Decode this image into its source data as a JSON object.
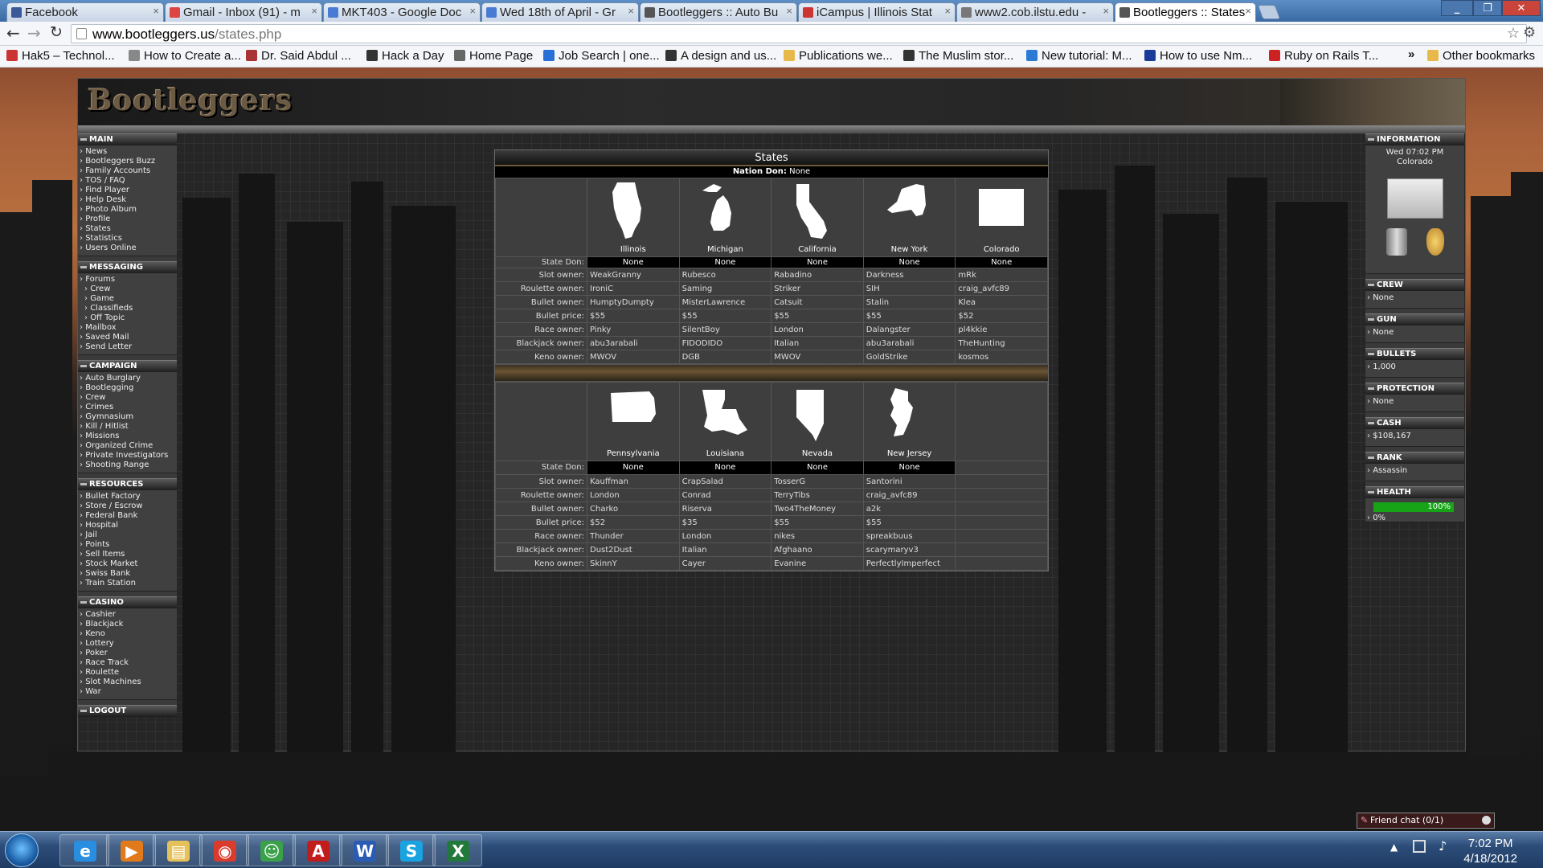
{
  "browser": {
    "tabs": [
      {
        "label": "Facebook",
        "color": "#3b5998"
      },
      {
        "label": "Gmail - Inbox (91) - m",
        "color": "#d44"
      },
      {
        "label": "MKT403 - Google Doc",
        "color": "#4a7bd4"
      },
      {
        "label": "Wed 18th of April - Gr",
        "color": "#4a7bd4"
      },
      {
        "label": "Bootleggers :: Auto Bu",
        "color": "#555"
      },
      {
        "label": "iCampus | Illinois Stat",
        "color": "#c33"
      },
      {
        "label": "www2.cob.ilstu.edu - ",
        "color": "#777"
      },
      {
        "label": "Bootleggers :: States",
        "color": "#555"
      }
    ],
    "url_host": "www.bootleggers.us",
    "url_path": "/states.php",
    "bookmarks": [
      {
        "label": "Hak5 – Technol...",
        "color": "#c33"
      },
      {
        "label": "How to Create a...",
        "color": "#888"
      },
      {
        "label": "Dr. Said Abdul ...",
        "color": "#a33"
      },
      {
        "label": "Hack a Day",
        "color": "#333"
      },
      {
        "label": "Home Page",
        "color": "#666"
      },
      {
        "label": "Job Search | one...",
        "color": "#2a6fd6"
      },
      {
        "label": "A design and us...",
        "color": "#333"
      },
      {
        "label": "Publications we...",
        "color": "#e7b94a"
      },
      {
        "label": "The Muslim stor...",
        "color": "#333"
      },
      {
        "label": "New tutorial: M...",
        "color": "#2a7ad6"
      },
      {
        "label": "How to use Nm...",
        "color": "#1a3a9a"
      },
      {
        "label": "Ruby on Rails T...",
        "color": "#c22"
      }
    ],
    "bookmarks_more": "»",
    "other_bookmarks": "Other bookmarks"
  },
  "site": {
    "logo": "Bootleggers"
  },
  "left_menu": [
    {
      "title": "MAIN",
      "items": [
        {
          "label": "News"
        },
        {
          "label": "Bootleggers Buzz"
        },
        {
          "label": "Family Accounts"
        },
        {
          "label": "TOS / FAQ"
        },
        {
          "label": "Find Player"
        },
        {
          "label": "Help Desk"
        },
        {
          "label": "Photo Album"
        },
        {
          "label": "Profile"
        },
        {
          "label": "States"
        },
        {
          "label": "Statistics"
        },
        {
          "label": "Users Online"
        }
      ]
    },
    {
      "title": "MESSAGING",
      "items": [
        {
          "label": "Forums"
        },
        {
          "label": "Crew",
          "sub": true
        },
        {
          "label": "Game",
          "sub": true
        },
        {
          "label": "Classifieds",
          "sub": true
        },
        {
          "label": "Off Topic",
          "sub": true
        },
        {
          "label": "Mailbox"
        },
        {
          "label": "Saved Mail"
        },
        {
          "label": "Send Letter"
        }
      ]
    },
    {
      "title": "CAMPAIGN",
      "items": [
        {
          "label": "Auto Burglary"
        },
        {
          "label": "Bootlegging"
        },
        {
          "label": "Crew"
        },
        {
          "label": "Crimes"
        },
        {
          "label": "Gymnasium"
        },
        {
          "label": "Kill / Hitlist"
        },
        {
          "label": "Missions"
        },
        {
          "label": "Organized Crime"
        },
        {
          "label": "Private Investigators"
        },
        {
          "label": "Shooting Range"
        }
      ]
    },
    {
      "title": "RESOURCES",
      "items": [
        {
          "label": "Bullet Factory"
        },
        {
          "label": "Store / Escrow"
        },
        {
          "label": "Federal Bank"
        },
        {
          "label": "Hospital"
        },
        {
          "label": "Jail"
        },
        {
          "label": "Points"
        },
        {
          "label": "Sell Items"
        },
        {
          "label": "Stock Market"
        },
        {
          "label": "Swiss Bank"
        },
        {
          "label": "Train Station"
        }
      ]
    },
    {
      "title": "CASINO",
      "items": [
        {
          "label": "Cashier"
        },
        {
          "label": "Blackjack"
        },
        {
          "label": "Keno"
        },
        {
          "label": "Lottery"
        },
        {
          "label": "Poker"
        },
        {
          "label": "Race Track"
        },
        {
          "label": "Roulette"
        },
        {
          "label": "Slot Machines"
        },
        {
          "label": "War"
        }
      ]
    },
    {
      "title": "LOGOUT",
      "items": []
    }
  ],
  "right_panel": {
    "info_title": "INFORMATION",
    "time": "Wed 07:02 PM",
    "location": "Colorado",
    "crew_title": "CREW",
    "crew": "None",
    "gun_title": "GUN",
    "gun": "None",
    "bullets_title": "BULLETS",
    "bullets": "1,000",
    "protection_title": "PROTECTION",
    "protection": "None",
    "cash_title": "CASH",
    "cash": "$108,167",
    "rank_title": "RANK",
    "rank": "Assassin",
    "health_title": "HEALTH",
    "health": "100%",
    "health_fraction": 1.0,
    "second_bar": "0%"
  },
  "states_panel": {
    "title": "States",
    "nation_don_label": "Nation Don:",
    "nation_don": "None",
    "row_labels": [
      "State Don:",
      "Slot owner:",
      "Roulette owner:",
      "Bullet owner:",
      "Bullet price:",
      "Race owner:",
      "Blackjack owner:",
      "Keno owner:"
    ],
    "group1": [
      {
        "name": "Illinois",
        "icon": "illinois-icon",
        "don": "None",
        "slot": "WeakGranny",
        "roulette": "IroniC",
        "bullet": "HumptyDumpty",
        "price": "$55",
        "race": "Pinky",
        "blackjack": "abu3arabali",
        "keno": "MWOV"
      },
      {
        "name": "Michigan",
        "icon": "michigan-icon",
        "don": "None",
        "slot": "Rubesco",
        "roulette": "Saming",
        "bullet": "MisterLawrence",
        "price": "$55",
        "race": "SilentBoy",
        "blackjack": "FIDODIDO",
        "keno": "DGB"
      },
      {
        "name": "California",
        "icon": "california-icon",
        "don": "None",
        "slot": "Rabadino",
        "roulette": "Striker",
        "bullet": "Catsuit",
        "price": "$55",
        "race": "London",
        "blackjack": "Italian",
        "keno": "MWOV"
      },
      {
        "name": "New York",
        "icon": "new-york-icon",
        "don": "None",
        "slot": "Darkness",
        "roulette": "SIH",
        "bullet": "Stalin",
        "price": "$55",
        "race": "Dalangster",
        "blackjack": "abu3arabali",
        "keno": "GoldStrike"
      },
      {
        "name": "Colorado",
        "icon": "colorado-icon",
        "don": "None",
        "slot": "mRk",
        "roulette": "craig_avfc89",
        "bullet": "Klea",
        "price": "$52",
        "race": "pl4kkie",
        "blackjack": "TheHunting",
        "keno": "kosmos"
      }
    ],
    "group2": [
      {
        "name": "Pennsylvania",
        "icon": "pennsylvania-icon",
        "don": "None",
        "slot": "Kauffman",
        "roulette": "London",
        "bullet": "Charko",
        "price": "$52",
        "race": "Thunder",
        "blackjack": "Dust2Dust",
        "keno": "SkinnY"
      },
      {
        "name": "Louisiana",
        "icon": "louisiana-icon",
        "don": "None",
        "slot": "CrapSalad",
        "roulette": "Conrad",
        "bullet": "Riserva",
        "price": "$35",
        "race": "London",
        "blackjack": "Italian",
        "keno": "Cayer"
      },
      {
        "name": "Nevada",
        "icon": "nevada-icon",
        "don": "None",
        "slot": "TosserG",
        "roulette": "TerryTibs",
        "bullet": "Two4TheMoney",
        "price": "$55",
        "race": "nikes",
        "blackjack": "Afghaano",
        "keno": "Evanine"
      },
      {
        "name": "New Jersey",
        "icon": "new-jersey-icon",
        "don": "None",
        "slot": "Santorini",
        "roulette": "craig_avfc89",
        "bullet": "a2k",
        "price": "$55",
        "race": "spreakbuus",
        "blackjack": "scarymaryv3",
        "keno": "PerfectlyImperfect"
      }
    ]
  },
  "friend_chat": "Friend chat (0/1)",
  "taskbar": {
    "apps": [
      {
        "name": "internet-explorer-icon",
        "glyph": "e",
        "color": "#2a8ee0"
      },
      {
        "name": "media-player-icon",
        "glyph": "▶",
        "color": "#e07a1a"
      },
      {
        "name": "file-explorer-icon",
        "glyph": "▤",
        "color": "#e6c15a"
      },
      {
        "name": "chrome-icon",
        "glyph": "◉",
        "color": "#d93c2c"
      },
      {
        "name": "messenger-icon",
        "glyph": "☺",
        "color": "#3aa04a"
      },
      {
        "name": "acrobat-icon",
        "glyph": "A",
        "color": "#c21d1d"
      },
      {
        "name": "word-icon",
        "glyph": "W",
        "color": "#2a5bb5"
      },
      {
        "name": "skype-icon",
        "glyph": "S",
        "color": "#19a3e0"
      },
      {
        "name": "excel-icon",
        "glyph": "X",
        "color": "#217a3c"
      }
    ],
    "time": "7:02 PM",
    "date": "4/18/2012"
  }
}
